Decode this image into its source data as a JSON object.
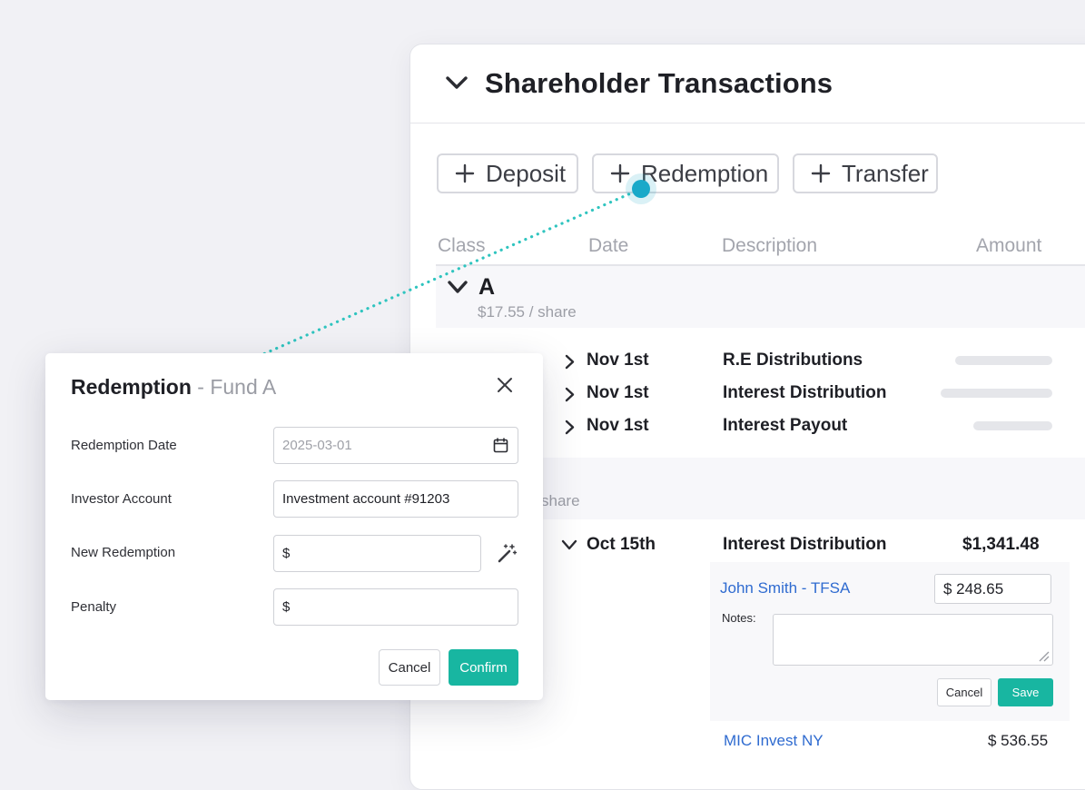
{
  "panel": {
    "title": "Shareholder Transactions",
    "actions": [
      {
        "label": "Deposit",
        "icon": "plus-icon"
      },
      {
        "label": "Redemption",
        "icon": "plus-icon"
      },
      {
        "label": "Transfer",
        "icon": "plus-icon"
      }
    ],
    "columns": [
      "Class",
      "Date",
      "Description",
      "Amount"
    ],
    "group_a": {
      "name": "A",
      "price": "$17.55 / share",
      "rows": [
        {
          "date": "Nov 1st",
          "description": "R.E Distributions"
        },
        {
          "date": "Nov 1st",
          "description": "Interest Distribution"
        },
        {
          "date": "Nov 1st",
          "description": "Interest Payout"
        }
      ]
    },
    "group_b": {
      "price_partial": "share",
      "row": {
        "date": "Oct 15th",
        "description": "Interest Distribution",
        "amount": "$1,341.48"
      },
      "allocations": [
        {
          "investor": "John Smith - TFSA",
          "amount": "$ 248.65"
        },
        {
          "investor": "MIC Invest NY",
          "amount": "$ 536.55"
        }
      ],
      "notes_label": "Notes:",
      "cancel_label": "Cancel",
      "save_label": "Save"
    }
  },
  "modal": {
    "title": "Redemption",
    "subtitle": " - Fund A",
    "fields": {
      "redemption_date": {
        "label": "Redemption Date",
        "placeholder": "2025-03-01"
      },
      "investor_account": {
        "label": "Investor Account",
        "value": "Investment account #91203"
      },
      "new_redemption": {
        "label": "New Redemption",
        "value": "$"
      },
      "penalty": {
        "label": "Penalty",
        "value": "$"
      }
    },
    "cancel_label": "Cancel",
    "confirm_label": "Confirm"
  },
  "colors": {
    "accent": "#18b6a1",
    "connector": "#2fc4bf",
    "link": "#2f6bd0",
    "dot": "#19a9c9"
  }
}
